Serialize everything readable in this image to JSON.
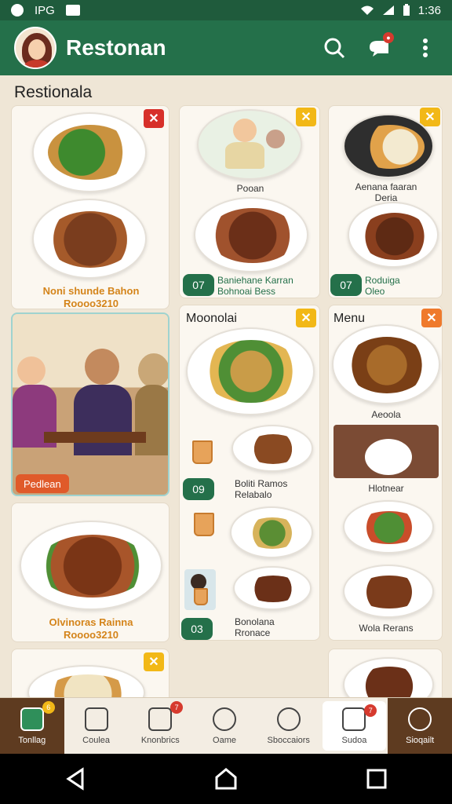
{
  "status_bar": {
    "left_text": "IPG",
    "time": "1:36"
  },
  "app_bar": {
    "title": "Restonan"
  },
  "page": {
    "heading": "Restionala"
  },
  "cards": {
    "c1": {
      "label_line1": "Noni shunde Bahon",
      "label_line2": "Roooo3210"
    },
    "c2": {
      "caption": "Pooan",
      "pill": "07",
      "label_line1": "Baniehane Karran",
      "label_line2": "Bohnoai Bess"
    },
    "c3": {
      "caption_line1": "Aenana faaran",
      "caption_line2": "Deria",
      "pill": "07",
      "label_line1": "Roduiga",
      "label_line2": "Oleo"
    },
    "c4": {
      "button": "Pedlean"
    },
    "c5": {
      "title": "Moonolai",
      "pill1": "09",
      "label1_line1": "Boliti Ramos",
      "label1_line2": "Relabalo",
      "pill2": "03",
      "label2_line1": "Bonolana",
      "label2_line2": "Rronace"
    },
    "c6": {
      "title": "Menu",
      "caption1": "Aeoola",
      "caption2": "Hlotnear",
      "caption3": "Wola Rerans"
    },
    "c7": {
      "label_line1": "Olvinoras Rainna",
      "label_line2": "Roooo3210"
    }
  },
  "bottom_nav": [
    {
      "label": "Tonllag",
      "badge": "6"
    },
    {
      "label": "Coulea",
      "badge": ""
    },
    {
      "label": "Knonbrics",
      "badge": "7"
    },
    {
      "label": "Oame",
      "badge": ""
    },
    {
      "label": "Sboccaiors",
      "badge": ""
    },
    {
      "label": "Sudoa",
      "badge": "7"
    },
    {
      "label": "Sioqailt",
      "badge": ""
    }
  ],
  "colors": {
    "primary": "#24704a",
    "accent_red": "#d7302a",
    "accent_yellow": "#f2b817"
  }
}
